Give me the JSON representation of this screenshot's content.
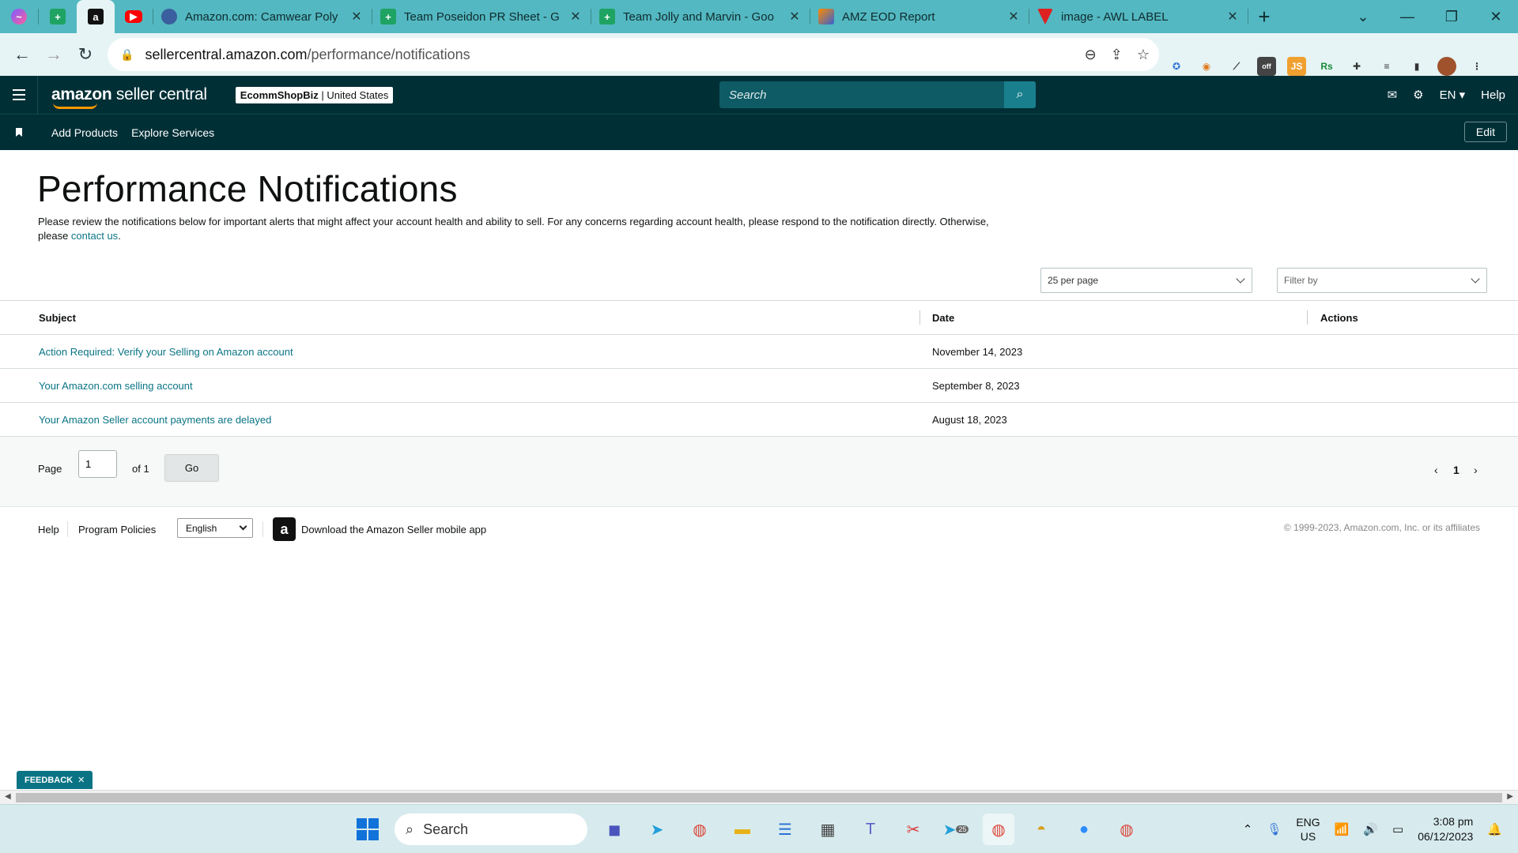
{
  "browser": {
    "tabs": [
      {
        "title": "Amazon.com: Camwear Poly",
        "favicon": "globe-icon"
      },
      {
        "title": "Team Poseidon PR Sheet - G",
        "favicon": "sheets-icon"
      },
      {
        "title": "Team Jolly and Marvin - Goo",
        "favicon": "sheets-icon"
      },
      {
        "title": "AMZ EOD Report",
        "favicon": "amz-eod-icon"
      },
      {
        "title": "image - AWL LABEL",
        "favicon": "awl-icon"
      }
    ],
    "url_host": "sellercentral.amazon.com",
    "url_path": "/performance/notifications",
    "extension_badge": "off",
    "extension_js": "JS",
    "extension_rs": "Rs"
  },
  "header": {
    "logo_bold": "amazon",
    "logo_rest": " seller central",
    "store_name": "EcommShopBiz",
    "store_region": " | United States",
    "search_placeholder": "Search",
    "lang": "EN",
    "help": "Help"
  },
  "subnav": {
    "items": [
      "Add Products",
      "Explore Services"
    ],
    "edit": "Edit"
  },
  "main": {
    "title": "Performance Notifications",
    "intro": "Please review the notifications below for important alerts that might affect your account health and ability to sell. For any concerns regarding account health, please respond to the notification directly. Otherwise, please ",
    "intro_link": "contact us",
    "intro_end": ".",
    "per_page": "25 per page",
    "filter_placeholder": "Filter by"
  },
  "table": {
    "headers": {
      "subject": "Subject",
      "date": "Date",
      "actions": "Actions"
    },
    "rows": [
      {
        "subject": "Action Required: Verify your Selling on Amazon account",
        "date": "November 14, 2023"
      },
      {
        "subject": "Your Amazon.com selling account",
        "date": "September 8, 2023"
      },
      {
        "subject": "Your Amazon Seller account payments are delayed",
        "date": "August 18, 2023"
      }
    ]
  },
  "pager": {
    "page_label": "Page",
    "page_value": "1",
    "of_label": "of 1",
    "go": "Go",
    "current": "1"
  },
  "footer": {
    "help": "Help",
    "policies": "Program Policies",
    "language": "English",
    "app_text": "Download the Amazon Seller mobile app",
    "copyright": "© 1999-2023, Amazon.com, Inc. or its affiliates"
  },
  "feedback": "FEEDBACK",
  "taskbar": {
    "search": "Search",
    "lang_top": "ENG",
    "lang_bottom": "US",
    "time": "3:08 pm",
    "date": "06/12/2023",
    "telegram_badge": "25"
  },
  "colors": {
    "tabbar": "#53b8c1",
    "header": "#002f36",
    "link": "#0a7485",
    "accent": "#ff9900"
  }
}
